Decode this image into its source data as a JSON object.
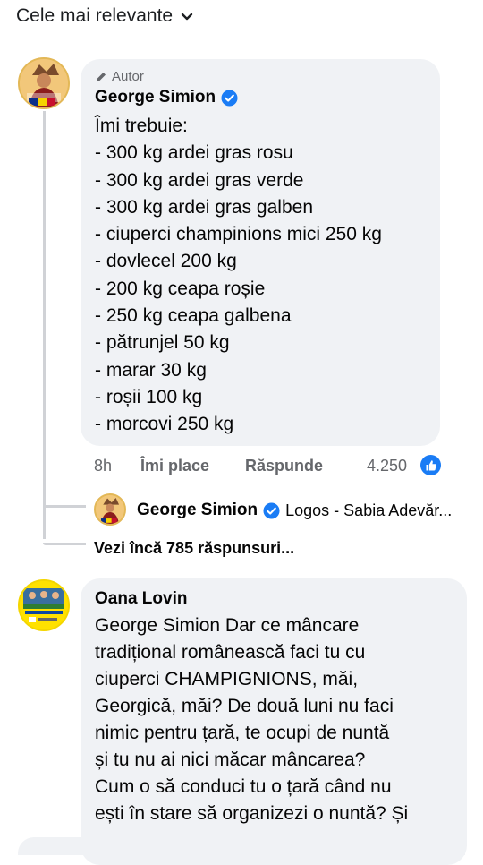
{
  "sort": {
    "label": "Cele mai relevante"
  },
  "comment1": {
    "author_tag": "Autor",
    "name": "George Simion",
    "lines": [
      "Îmi trebuie:",
      "- 300 kg ardei gras rosu",
      "- 300 kg ardei gras verde",
      "- 300 kg ardei gras galben",
      "- ciuperci champinions mici 250 kg",
      "- dovlecel 200 kg",
      "- 200 kg ceapa roșie",
      "- 250 kg ceapa galbena",
      "- pătrunjel 50 kg",
      "- marar 30 kg",
      "- roșii 100 kg",
      "- morcovi 250 kg"
    ],
    "time": "8h",
    "like_label": "Îmi place",
    "reply_label": "Răspunde",
    "reactions_count": "4.250"
  },
  "reply_preview": {
    "name": "George Simion",
    "text": "Logos - Sabia Adevăr..."
  },
  "more_replies": "Vezi încă 785 răspunsuri...",
  "comment2": {
    "name": "Oana Lovin",
    "lines": [
      "George Simion Dar ce mâncare",
      "tradițional românească faci tu cu",
      "ciuperci CHAMPIGNIONS, măi,",
      "Georgică, măi? De două luni nu faci",
      "nimic pentru țară, te ocupi de nuntă",
      "și tu nu ai nici măcar mâncarea?",
      "Cum o să conduci tu o țară când nu",
      "ești în stare să organizezi o nuntă? Și"
    ]
  },
  "colors": {
    "accent": "#1a7cf5",
    "bubble": "#f0f2f5",
    "muted": "#65676b"
  }
}
